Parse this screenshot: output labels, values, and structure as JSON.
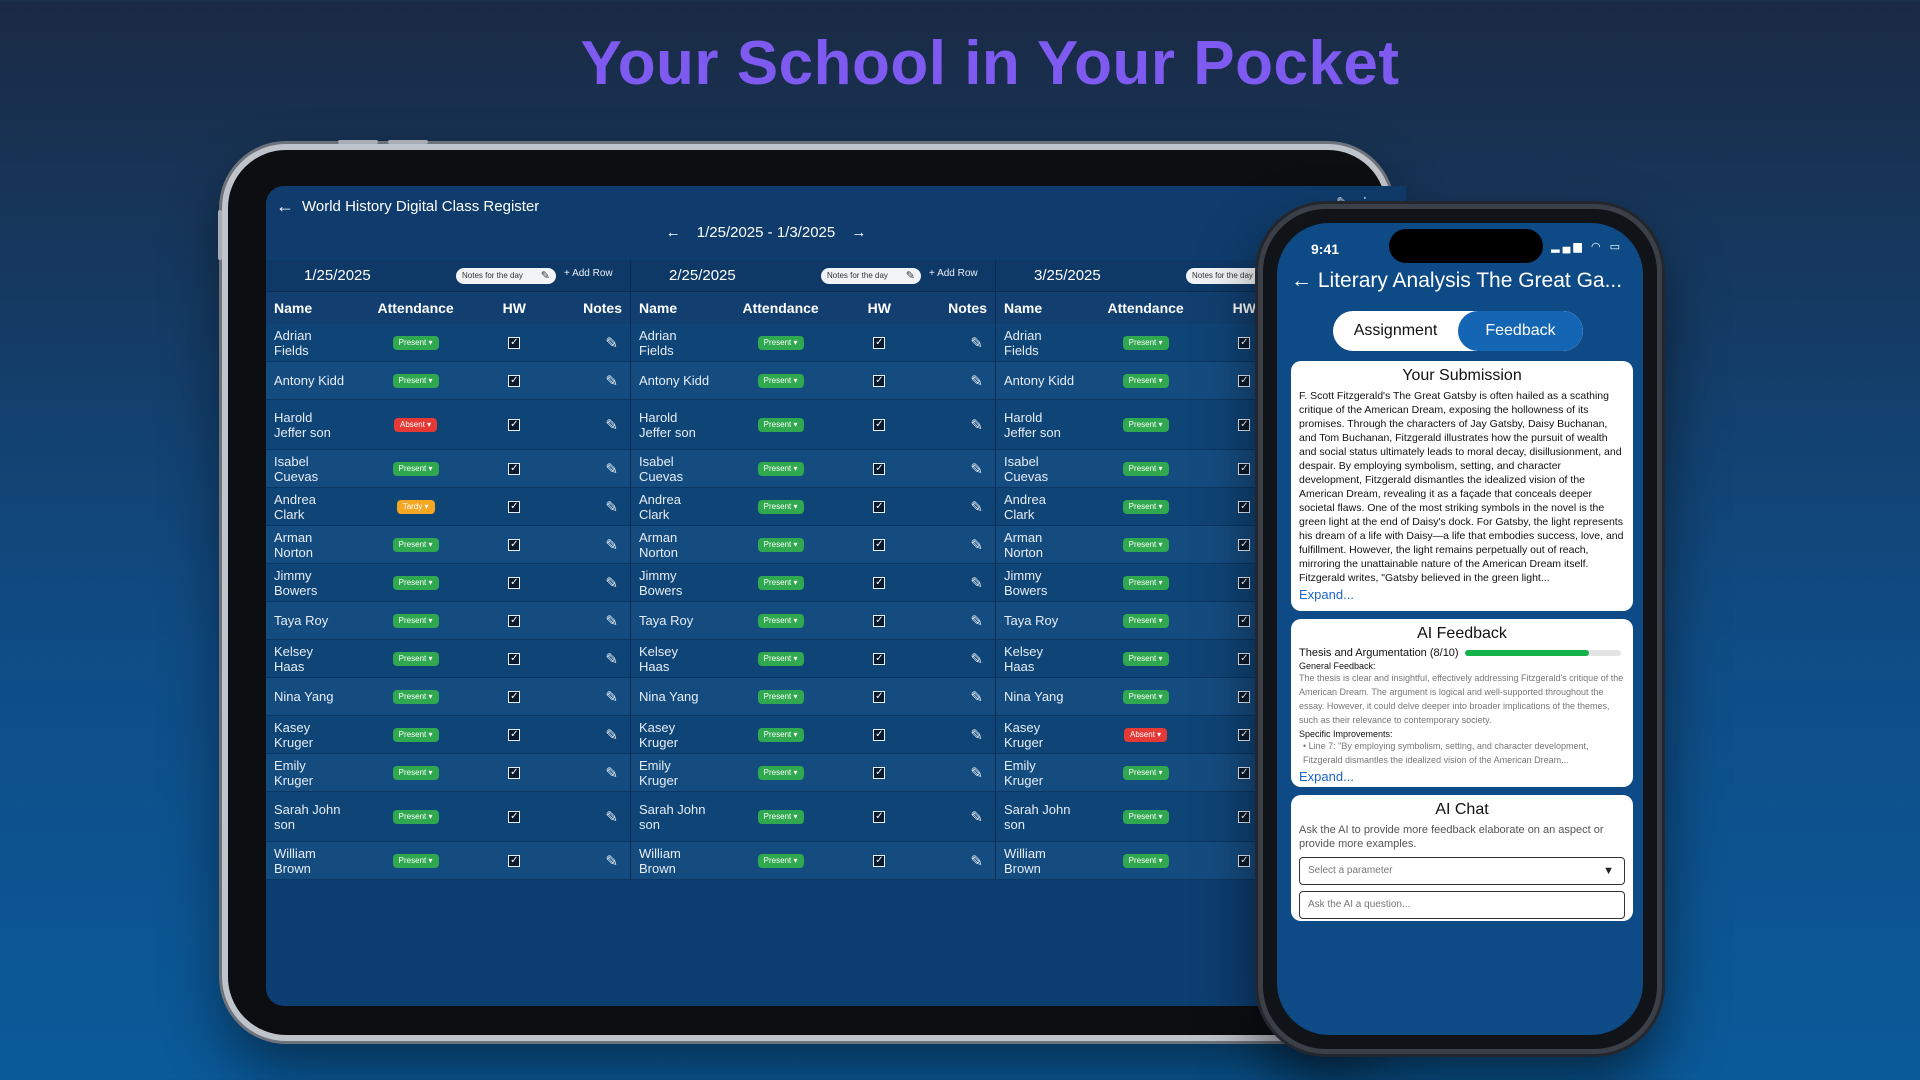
{
  "headline": "Your School in Your Pocket",
  "tablet": {
    "back_icon": "←",
    "title": "World History Digital Class Register",
    "range_prev": "←",
    "range_text": "1/25/2025 - 1/3/2025",
    "range_next": "→",
    "column_labels": {
      "name": "Name",
      "attendance": "Attendance",
      "hw": "HW",
      "notes": "Notes"
    },
    "notes_pill": "Notes for the day",
    "add_row": "+ Add Row",
    "days": [
      {
        "date": "1/25/2025",
        "rows": [
          [
            "Adrian Fields",
            "Present"
          ],
          [
            "Antony Kidd",
            "Present"
          ],
          [
            "Harold Jeffer son",
            "Absent"
          ],
          [
            "Isabel Cuevas",
            "Present"
          ],
          [
            "Andrea Clark",
            "Tardy"
          ],
          [
            "Arman Norton",
            "Present"
          ],
          [
            "Jimmy Bowers",
            "Present"
          ],
          [
            "Taya Roy",
            "Present"
          ],
          [
            "Kelsey Haas",
            "Present"
          ],
          [
            "Nina Yang",
            "Present"
          ],
          [
            "Kasey Kruger",
            "Present"
          ],
          [
            "Emily Kruger",
            "Present"
          ],
          [
            "Sarah John son",
            "Present"
          ],
          [
            "William Brown",
            "Present"
          ]
        ]
      },
      {
        "date": "2/25/2025",
        "rows": [
          [
            "Adrian Fields",
            "Present"
          ],
          [
            "Antony Kidd",
            "Present"
          ],
          [
            "Harold Jeffer son",
            "Present"
          ],
          [
            "Isabel Cuevas",
            "Present"
          ],
          [
            "Andrea Clark",
            "Present"
          ],
          [
            "Arman Norton",
            "Present"
          ],
          [
            "Jimmy Bowers",
            "Present"
          ],
          [
            "Taya Roy",
            "Present"
          ],
          [
            "Kelsey Haas",
            "Present"
          ],
          [
            "Nina Yang",
            "Present"
          ],
          [
            "Kasey Kruger",
            "Present"
          ],
          [
            "Emily Kruger",
            "Present"
          ],
          [
            "Sarah John son",
            "Present"
          ],
          [
            "William Brown",
            "Present"
          ]
        ]
      },
      {
        "date": "3/25/2025",
        "rows": [
          [
            "Adrian Fields",
            "Present"
          ],
          [
            "Antony Kidd",
            "Present"
          ],
          [
            "Harold Jeffer son",
            "Present"
          ],
          [
            "Isabel Cuevas",
            "Present"
          ],
          [
            "Andrea Clark",
            "Present"
          ],
          [
            "Arman Norton",
            "Present"
          ],
          [
            "Jimmy Bowers",
            "Present"
          ],
          [
            "Taya Roy",
            "Present"
          ],
          [
            "Kelsey Haas",
            "Present"
          ],
          [
            "Nina Yang",
            "Present"
          ],
          [
            "Kasey Kruger",
            "Absent"
          ],
          [
            "Emily Kruger",
            "Present"
          ],
          [
            "Sarah John son",
            "Present"
          ],
          [
            "William Brown",
            "Present"
          ]
        ]
      }
    ],
    "status_colors": {
      "Present": "#2fa84f",
      "Absent": "#e53935",
      "Tardy": "#f5a623"
    }
  },
  "phone": {
    "time": "9:41",
    "status_icons": "▂▄▆ ◠ ▭",
    "back_icon": "←",
    "title": "Literary Analysis The Great Ga...",
    "tabs": [
      "Assignment",
      "Feedback"
    ],
    "active_tab": "Feedback",
    "submission": {
      "heading": "Your Submission",
      "text": "F. Scott Fitzgerald's The Great Gatsby is often hailed as a scathing critique of the American Dream, exposing the hollowness of its promises. Through the characters of Jay Gatsby, Daisy Buchanan, and Tom Buchanan, Fitzgerald illustrates how the pursuit of wealth and social status ultimately leads to moral decay, disillusionment, and despair. By employing symbolism, setting, and character development, Fitzgerald dismantles the idealized vision of the American Dream, revealing it as a façade that conceals deeper societal flaws. One of the most striking symbols in the novel is the green light at the end of Daisy's dock. For Gatsby, the light represents his dream of a life with Daisy—a life that embodies success, love, and fulfillment. However, the light remains perpetually out of reach, mirroring the unattainable nature of the American Dream itself. Fitzgerald writes, \"Gatsby believed in the green light...",
      "expand": "Expand..."
    },
    "ai_feedback": {
      "heading": "AI Feedback",
      "thesis_label": "Thesis and Argumentation (8/10)",
      "thesis_score": 0.8,
      "general_label": "General Feedback:",
      "general_text": "The thesis is clear and insightful, effectively addressing Fitzgerald's critique of the American Dream. The argument is logical and well-supported throughout the essay. However, it could delve deeper into broader implications of the themes, such as their relevance to contemporary society.",
      "specific_label": "Specific Improvements:",
      "specific_text": "• Line 7: \"By employing symbolism, setting, and character development, Fitzgerald dismantles the idealized vision of the American Dream...",
      "expand": "Expand..."
    },
    "ai_chat": {
      "heading": "AI Chat",
      "description": "Ask the AI to provide more feedback elaborate on an aspect or provide more examples.",
      "select_placeholder": "Select a parameter",
      "input_placeholder": "Ask the AI a question..."
    }
  }
}
